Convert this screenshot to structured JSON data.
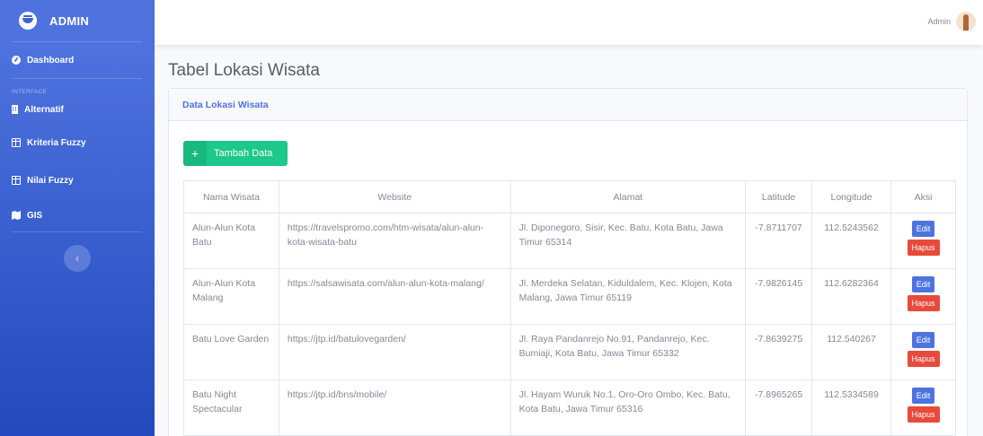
{
  "sidebar": {
    "brand": "ADMIN",
    "dashboard": "Dashboard",
    "heading": "INTERFACE",
    "items": [
      {
        "label": "Alternatif",
        "icon": "building-icon"
      },
      {
        "label": "Kriteria Fuzzy",
        "icon": "table-icon"
      },
      {
        "label": "Nilai Fuzzy",
        "icon": "table-icon"
      },
      {
        "label": "GIS",
        "icon": "map-icon"
      }
    ],
    "toggle": "‹"
  },
  "topbar": {
    "user_name": "Admin"
  },
  "page": {
    "title": "Tabel Lokasi Wisata"
  },
  "card": {
    "header": "Data Lokasi Wisata",
    "add_button": "Tambah Data",
    "add_icon": "+"
  },
  "table": {
    "headers": [
      "Nama Wisata",
      "Website",
      "Alamat",
      "Latitude",
      "Longitude",
      "Aksi"
    ],
    "edit_label": "Edit",
    "delete_label": "Hapus",
    "rows": [
      {
        "nama": "Alun-Alun Kota Batu",
        "website": "https://travelspromo.com/htm-wisata/alun-alun-kota-wisata-batu",
        "alamat": "Jl. Diponegoro, Sisir, Kec. Batu, Kota Batu, Jawa Timur 65314",
        "lat": "-7.8711707",
        "lng": "112.5243562"
      },
      {
        "nama": "Alun-Alun Kota Malang",
        "website": "https://salsawisata.com/alun-alun-kota-malang/",
        "alamat": "Jl. Merdeka Selatan, Kiduldalem, Kec. Klojen, Kota Malang, Jawa Timur 65119",
        "lat": "-7.9826145",
        "lng": "112.6282364"
      },
      {
        "nama": "Batu Love Garden",
        "website": "https://jtp.id/batulovegarden/",
        "alamat": "Jl. Raya Pandanrejo No.91, Pandanrejo, Kec. Bumiaji, Kota Batu, Jawa Timur 65332",
        "lat": "-7.8639275",
        "lng": "112.540267"
      },
      {
        "nama": "Batu Night Spectacular",
        "website": "https://jtp.id/bns/mobile/",
        "alamat": "Jl. Hayam Wuruk No.1, Oro-Oro Ombo, Kec. Batu, Kota Batu, Jawa Timur 65316",
        "lat": "-7.8965265",
        "lng": "112.5334589"
      }
    ]
  },
  "colors": {
    "sidebar": "#4e73df",
    "success": "#1cc88a",
    "danger": "#e74a3b",
    "text": "#858796"
  }
}
